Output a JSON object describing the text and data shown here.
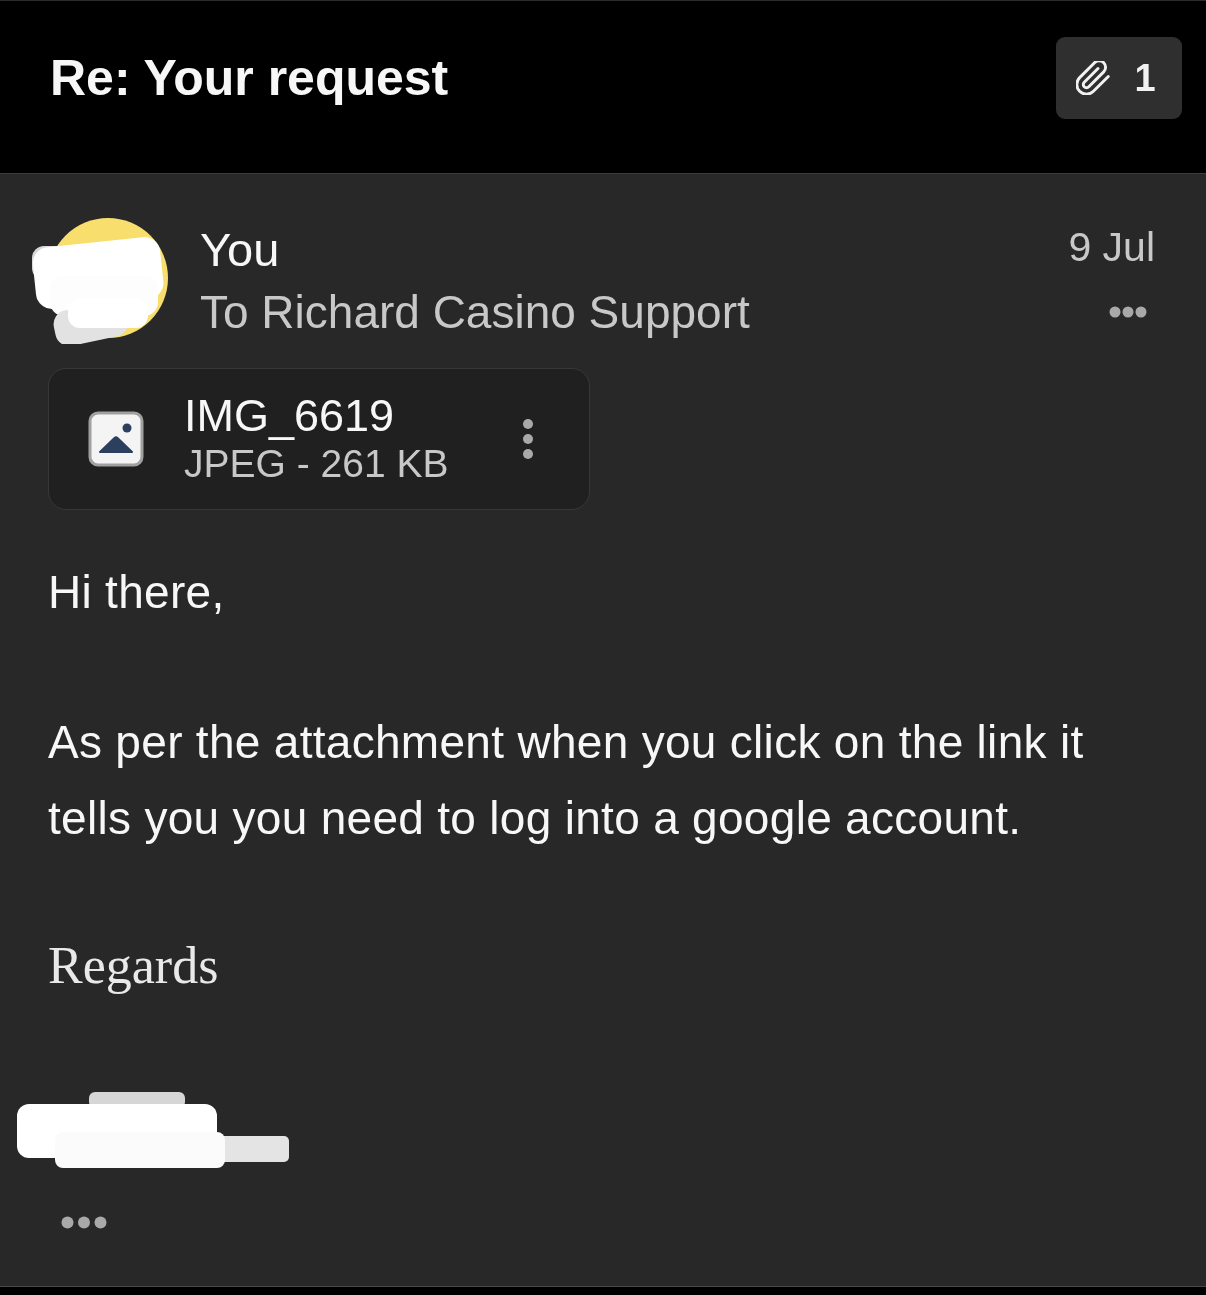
{
  "header": {
    "title": "Re: Your request",
    "attachments_button": {
      "count": "1"
    }
  },
  "message": {
    "avatar": {
      "redacted": true
    },
    "sender": "You",
    "recipients": "To Richard Casino Support",
    "date": "9 Jul",
    "attachments": [
      {
        "name": "IMG_6619",
        "details": "JPEG - 261 KB"
      }
    ],
    "body": [
      "Hi there,",
      "As per the attachment when you click on the link it tells you you need to log into a google account."
    ],
    "closing": "Regards",
    "signature": {
      "redacted": true
    }
  }
}
